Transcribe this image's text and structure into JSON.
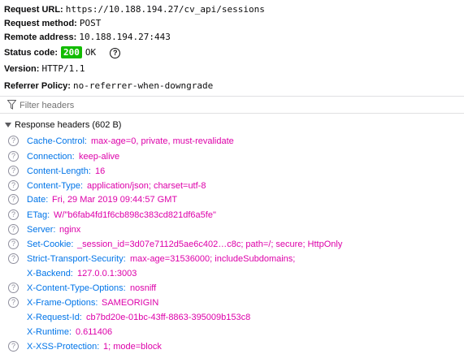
{
  "summary": {
    "request_url_label": "Request URL:",
    "request_url": "https://10.188.194.27/cv_api/sessions",
    "request_method_label": "Request method:",
    "request_method": "POST",
    "remote_address_label": "Remote address:",
    "remote_address": "10.188.194.27:443",
    "status_code_label": "Status code:",
    "status_code": "200",
    "status_text": "OK",
    "status_color": "#12bc00",
    "version_label": "Version:",
    "version": "HTTP/1.1",
    "referrer_policy_label": "Referrer Policy:",
    "referrer_policy": "no-referrer-when-downgrade"
  },
  "filter": {
    "placeholder": "Filter headers",
    "icon": "filter-icon"
  },
  "response_headers": {
    "title": "Response headers (602 B)",
    "items": [
      {
        "name": "Cache-Control:",
        "value": "max-age=0, private, must-revalidate",
        "help": true
      },
      {
        "name": "Connection:",
        "value": "keep-alive",
        "help": true
      },
      {
        "name": "Content-Length:",
        "value": "16",
        "help": true
      },
      {
        "name": "Content-Type:",
        "value": "application/json; charset=utf-8",
        "help": true
      },
      {
        "name": "Date:",
        "value": "Fri, 29 Mar 2019 09:44:57 GMT",
        "help": true
      },
      {
        "name": "ETag:",
        "value": "W/\"b6fab4fd1f6cb898c383cd821df6a5fe\"",
        "help": true
      },
      {
        "name": "Server:",
        "value": "nginx",
        "help": true
      },
      {
        "name": "Set-Cookie:",
        "value": "_session_id=3d07e7112d5ae6c402…c8c; path=/; secure; HttpOnly",
        "help": true
      },
      {
        "name": "Strict-Transport-Security:",
        "value": "max-age=31536000; includeSubdomains;",
        "help": true
      },
      {
        "name": "X-Backend:",
        "value": "127.0.0.1:3003",
        "help": false
      },
      {
        "name": "X-Content-Type-Options:",
        "value": "nosniff",
        "help": true
      },
      {
        "name": "X-Frame-Options:",
        "value": "SAMEORIGIN",
        "help": true
      },
      {
        "name": "X-Request-Id:",
        "value": "cb7bd20e-01bc-43ff-8863-395009b153c8",
        "help": false
      },
      {
        "name": "X-Runtime:",
        "value": "0.611406",
        "help": false
      },
      {
        "name": "X-XSS-Protection:",
        "value": "1; mode=block",
        "help": true
      }
    ]
  },
  "colors": {
    "header_name": "#0074e8",
    "header_value": "#dd00a9"
  }
}
